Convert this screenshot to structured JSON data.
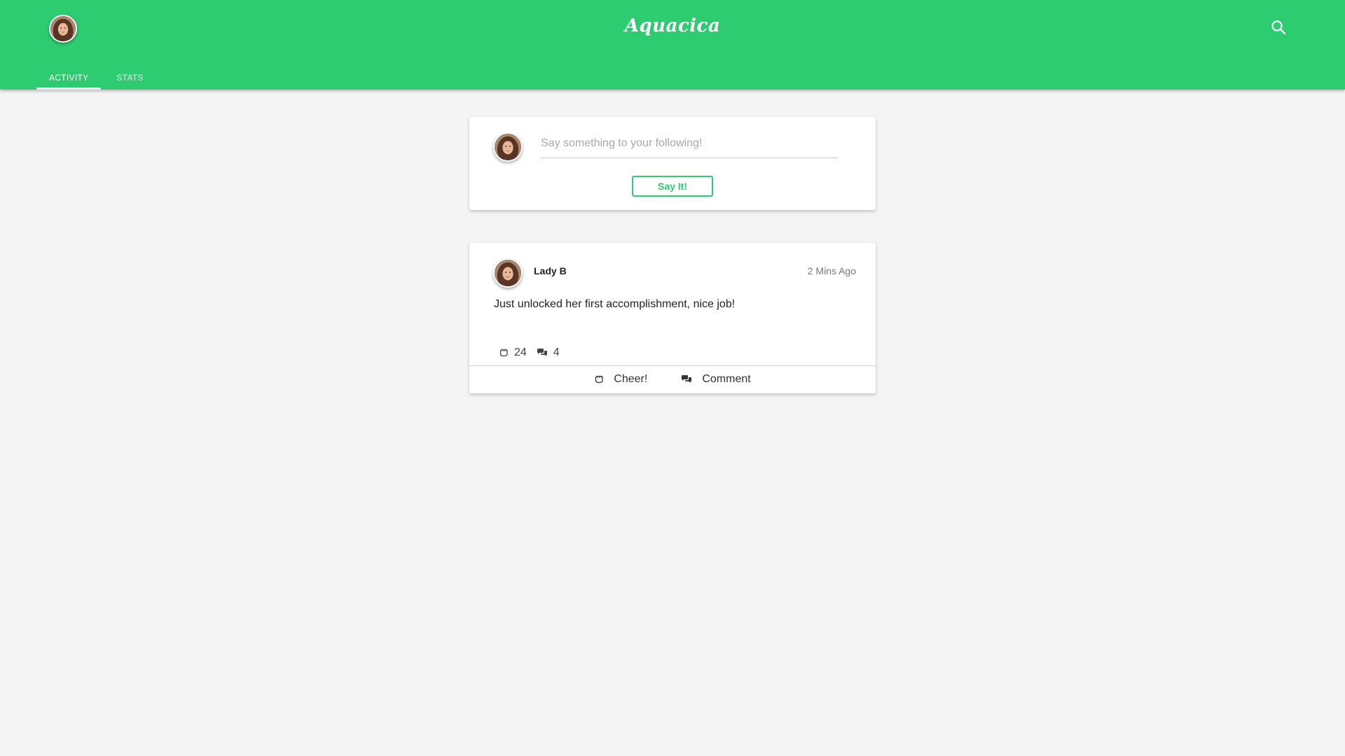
{
  "app": {
    "brand": "Aquacica",
    "accent_color": "#2ecc71"
  },
  "header": {
    "avatar_icon": "user-avatar",
    "search_icon": "search-icon",
    "tabs": [
      {
        "label": "ACTIVITY",
        "active": true
      },
      {
        "label": "STATS",
        "active": false
      }
    ]
  },
  "composer": {
    "placeholder": "Say something to your following!",
    "value": "",
    "submit_label": "Say It!"
  },
  "feed": {
    "posts": [
      {
        "author": "Lady B",
        "time": "2 Mins Ago",
        "text": "Just unlocked her first accomplishment, nice job!",
        "cheer_count": "24",
        "comment_count": "4",
        "cheer_label": "Cheer!",
        "comment_label": "Comment",
        "cheer_icon": "fist-icon",
        "comment_icon": "comments-icon"
      }
    ]
  }
}
